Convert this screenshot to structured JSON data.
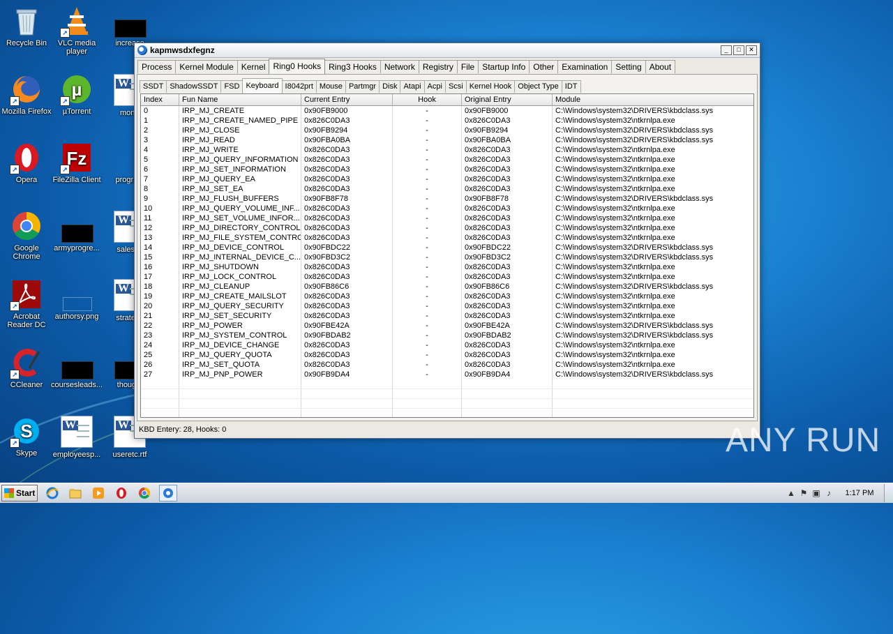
{
  "desktop": {
    "icons": [
      {
        "label": "Recycle Bin"
      },
      {
        "label": "VLC media player"
      },
      {
        "label": "increase"
      },
      {
        "label": "Mozilla Firefox"
      },
      {
        "label": "µTorrent"
      },
      {
        "label": "montr"
      },
      {
        "label": "Opera"
      },
      {
        "label": "FileZilla Client"
      },
      {
        "label": "program"
      },
      {
        "label": "Google Chrome"
      },
      {
        "label": "armyprogre..."
      },
      {
        "label": "salesco"
      },
      {
        "label": "Acrobat Reader DC"
      },
      {
        "label": "authorsy.png"
      },
      {
        "label": "strategy"
      },
      {
        "label": "CCleaner"
      },
      {
        "label": "coursesleads..."
      },
      {
        "label": "thought"
      },
      {
        "label": "Skype"
      },
      {
        "label": "employeesp..."
      },
      {
        "label": "useretc.rtf"
      }
    ]
  },
  "window": {
    "title": "kapmwsdxfegnz",
    "main_tabs": [
      "Process",
      "Kernel Module",
      "Kernel",
      "Ring0 Hooks",
      "Ring3 Hooks",
      "Network",
      "Registry",
      "File",
      "Startup Info",
      "Other",
      "Examination",
      "Setting",
      "About"
    ],
    "active_main_tab": "Ring0 Hooks",
    "sub_tabs": [
      "SSDT",
      "ShadowSSDT",
      "FSD",
      "Keyboard",
      "I8042prt",
      "Mouse",
      "Partmgr",
      "Disk",
      "Atapi",
      "Acpi",
      "Scsi",
      "Kernel Hook",
      "Object Type",
      "IDT"
    ],
    "active_sub_tab": "Keyboard",
    "columns": [
      "Index",
      "Fun Name",
      "Current Entry",
      "Hook",
      "Original Entry",
      "Module"
    ],
    "rows": [
      [
        "0",
        "IRP_MJ_CREATE",
        "0x90FB9000",
        "-",
        "0x90FB9000",
        "C:\\Windows\\system32\\DRIVERS\\kbdclass.sys"
      ],
      [
        "1",
        "IRP_MJ_CREATE_NAMED_PIPE",
        "0x826C0DA3",
        "-",
        "0x826C0DA3",
        "C:\\Windows\\system32\\ntkrnlpa.exe"
      ],
      [
        "2",
        "IRP_MJ_CLOSE",
        "0x90FB9294",
        "-",
        "0x90FB9294",
        "C:\\Windows\\system32\\DRIVERS\\kbdclass.sys"
      ],
      [
        "3",
        "IRP_MJ_READ",
        "0x90FBA0BA",
        "-",
        "0x90FBA0BA",
        "C:\\Windows\\system32\\DRIVERS\\kbdclass.sys"
      ],
      [
        "4",
        "IRP_MJ_WRITE",
        "0x826C0DA3",
        "-",
        "0x826C0DA3",
        "C:\\Windows\\system32\\ntkrnlpa.exe"
      ],
      [
        "5",
        "IRP_MJ_QUERY_INFORMATION",
        "0x826C0DA3",
        "-",
        "0x826C0DA3",
        "C:\\Windows\\system32\\ntkrnlpa.exe"
      ],
      [
        "6",
        "IRP_MJ_SET_INFORMATION",
        "0x826C0DA3",
        "-",
        "0x826C0DA3",
        "C:\\Windows\\system32\\ntkrnlpa.exe"
      ],
      [
        "7",
        "IRP_MJ_QUERY_EA",
        "0x826C0DA3",
        "-",
        "0x826C0DA3",
        "C:\\Windows\\system32\\ntkrnlpa.exe"
      ],
      [
        "8",
        "IRP_MJ_SET_EA",
        "0x826C0DA3",
        "-",
        "0x826C0DA3",
        "C:\\Windows\\system32\\ntkrnlpa.exe"
      ],
      [
        "9",
        "IRP_MJ_FLUSH_BUFFERS",
        "0x90FB8F78",
        "-",
        "0x90FB8F78",
        "C:\\Windows\\system32\\DRIVERS\\kbdclass.sys"
      ],
      [
        "10",
        "IRP_MJ_QUERY_VOLUME_INF...",
        "0x826C0DA3",
        "-",
        "0x826C0DA3",
        "C:\\Windows\\system32\\ntkrnlpa.exe"
      ],
      [
        "11",
        "IRP_MJ_SET_VOLUME_INFOR...",
        "0x826C0DA3",
        "-",
        "0x826C0DA3",
        "C:\\Windows\\system32\\ntkrnlpa.exe"
      ],
      [
        "12",
        "IRP_MJ_DIRECTORY_CONTROL",
        "0x826C0DA3",
        "-",
        "0x826C0DA3",
        "C:\\Windows\\system32\\ntkrnlpa.exe"
      ],
      [
        "13",
        "IRP_MJ_FILE_SYSTEM_CONTROL",
        "0x826C0DA3",
        "-",
        "0x826C0DA3",
        "C:\\Windows\\system32\\ntkrnlpa.exe"
      ],
      [
        "14",
        "IRP_MJ_DEVICE_CONTROL",
        "0x90FBDC22",
        "-",
        "0x90FBDC22",
        "C:\\Windows\\system32\\DRIVERS\\kbdclass.sys"
      ],
      [
        "15",
        "IRP_MJ_INTERNAL_DEVICE_C...",
        "0x90FBD3C2",
        "-",
        "0x90FBD3C2",
        "C:\\Windows\\system32\\DRIVERS\\kbdclass.sys"
      ],
      [
        "16",
        "IRP_MJ_SHUTDOWN",
        "0x826C0DA3",
        "-",
        "0x826C0DA3",
        "C:\\Windows\\system32\\ntkrnlpa.exe"
      ],
      [
        "17",
        "IRP_MJ_LOCK_CONTROL",
        "0x826C0DA3",
        "-",
        "0x826C0DA3",
        "C:\\Windows\\system32\\ntkrnlpa.exe"
      ],
      [
        "18",
        "IRP_MJ_CLEANUP",
        "0x90FB86C6",
        "-",
        "0x90FB86C6",
        "C:\\Windows\\system32\\DRIVERS\\kbdclass.sys"
      ],
      [
        "19",
        "IRP_MJ_CREATE_MAILSLOT",
        "0x826C0DA3",
        "-",
        "0x826C0DA3",
        "C:\\Windows\\system32\\ntkrnlpa.exe"
      ],
      [
        "20",
        "IRP_MJ_QUERY_SECURITY",
        "0x826C0DA3",
        "-",
        "0x826C0DA3",
        "C:\\Windows\\system32\\ntkrnlpa.exe"
      ],
      [
        "21",
        "IRP_MJ_SET_SECURITY",
        "0x826C0DA3",
        "-",
        "0x826C0DA3",
        "C:\\Windows\\system32\\ntkrnlpa.exe"
      ],
      [
        "22",
        "IRP_MJ_POWER",
        "0x90FBE42A",
        "-",
        "0x90FBE42A",
        "C:\\Windows\\system32\\DRIVERS\\kbdclass.sys"
      ],
      [
        "23",
        "IRP_MJ_SYSTEM_CONTROL",
        "0x90FBDAB2",
        "-",
        "0x90FBDAB2",
        "C:\\Windows\\system32\\DRIVERS\\kbdclass.sys"
      ],
      [
        "24",
        "IRP_MJ_DEVICE_CHANGE",
        "0x826C0DA3",
        "-",
        "0x826C0DA3",
        "C:\\Windows\\system32\\ntkrnlpa.exe"
      ],
      [
        "25",
        "IRP_MJ_QUERY_QUOTA",
        "0x826C0DA3",
        "-",
        "0x826C0DA3",
        "C:\\Windows\\system32\\ntkrnlpa.exe"
      ],
      [
        "26",
        "IRP_MJ_SET_QUOTA",
        "0x826C0DA3",
        "-",
        "0x826C0DA3",
        "C:\\Windows\\system32\\ntkrnlpa.exe"
      ],
      [
        "27",
        "IRP_MJ_PNP_POWER",
        "0x90FB9DA4",
        "-",
        "0x90FB9DA4",
        "C:\\Windows\\system32\\DRIVERS\\kbdclass.sys"
      ]
    ],
    "status": "KBD Entery: 28,  Hooks: 0"
  },
  "taskbar": {
    "start_label": "Start",
    "clock": "1:17 PM",
    "apps": [
      "ie-icon",
      "explorer-icon",
      "media-player-icon",
      "opera-icon",
      "chrome-icon",
      "app-icon"
    ]
  },
  "watermark": "ANY RUN",
  "colors": {
    "desktop": "#1a7fcf",
    "window_bg": "#ece9e3"
  }
}
